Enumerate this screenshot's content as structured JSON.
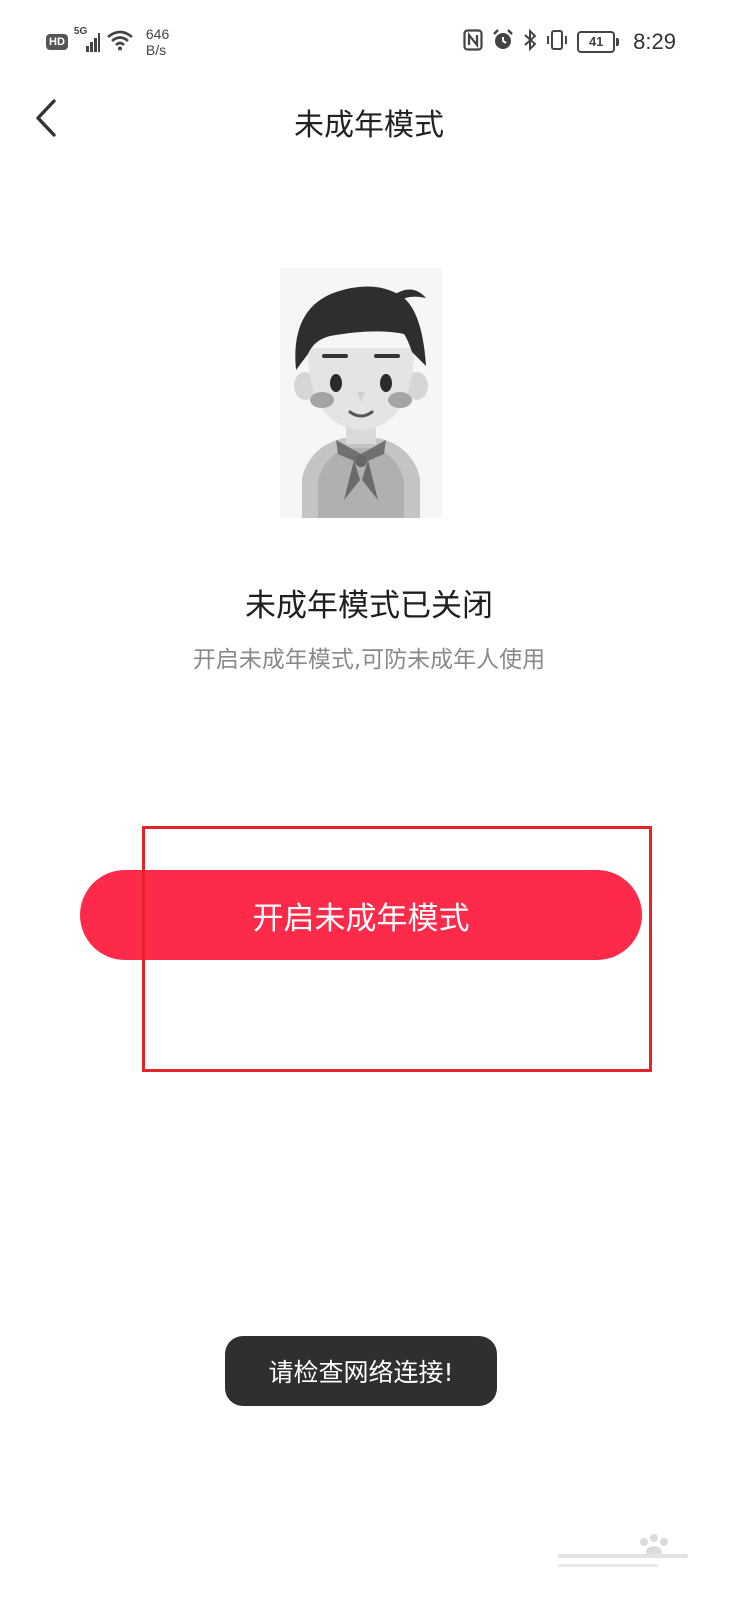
{
  "status_bar": {
    "hd": "HD",
    "network": "5G",
    "net_speed_value": "646",
    "net_speed_unit": "B/s",
    "battery": "41",
    "time": "8:29",
    "icons": [
      "signal-icon",
      "wifi-icon",
      "nfc-icon",
      "alarm-icon",
      "bluetooth-icon",
      "vibrate-icon",
      "battery-icon"
    ]
  },
  "header": {
    "back_icon": "chevron-left-icon",
    "title": "未成年模式"
  },
  "main": {
    "illustration_icon": "boy-with-red-scarf-avatar",
    "status_title": "未成年模式已关闭",
    "status_desc": "开启未成年模式,可防未成年人使用",
    "enable_button": "开启未成年模式"
  },
  "toast": {
    "message": "请检查网络连接!"
  },
  "colors": {
    "accent": "#fe2a4a",
    "highlight_border": "#e5232b",
    "toast_bg": "#2f2f2f",
    "subtext": "#8a8a8a"
  }
}
